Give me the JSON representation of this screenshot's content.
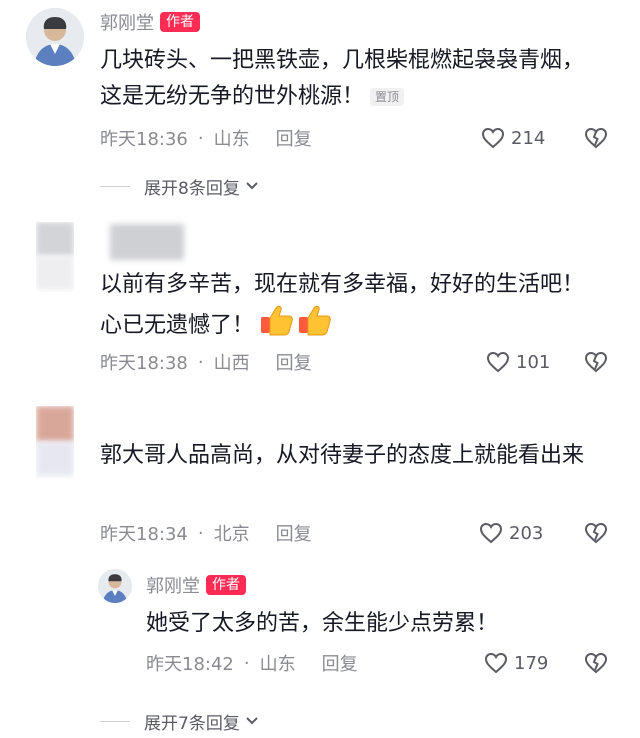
{
  "comments": [
    {
      "username": "郭刚堂",
      "author_tag": "作者",
      "text": "几块砖头、一把黑铁壶，几根柴棍燃起袅袅青烟，这是无纷无争的世外桃源！",
      "pin_tag": "置顶",
      "time": "昨天18:36",
      "location": "山东",
      "reply_label": "回复",
      "like_count": "214",
      "expand_label": "展开8条回复"
    },
    {
      "username": "",
      "text": "以前有多辛苦，现在就有多幸福，好好的生活吧！心已无遗憾了！",
      "time": "昨天18:38",
      "location": "山西",
      "reply_label": "回复",
      "like_count": "101"
    },
    {
      "username": "",
      "text": "郭大哥人品高尚，从对待妻子的态度上就能看出来",
      "time": "昨天18:34",
      "location": "北京",
      "reply_label": "回复",
      "like_count": "203"
    }
  ],
  "reply": {
    "username": "郭刚堂",
    "author_tag": "作者",
    "text": "她受了太多的苦，余生能少点劳累！",
    "time": "昨天18:42",
    "location": "山东",
    "reply_label": "回复",
    "like_count": "179"
  },
  "expand_more": {
    "label": "展开7条回复"
  },
  "colors": {
    "author_tag": "#fe2c55",
    "secondary_text": "#8a8b91"
  },
  "icons": [
    "heart-outline-icon",
    "broken-heart-icon",
    "chevron-down-icon",
    "thumbs-up-emoji"
  ]
}
